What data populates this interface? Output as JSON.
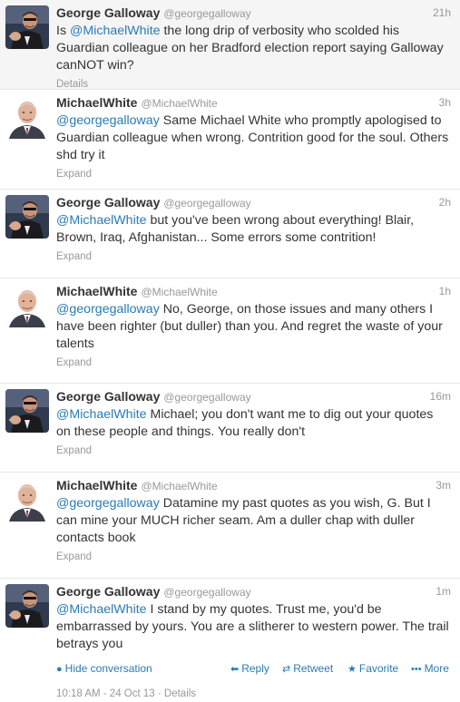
{
  "tweets": [
    {
      "author": "george",
      "fullname": "George Galloway",
      "username": "@georgegalloway",
      "time": "21h",
      "parts": [
        {
          "t": "Is ",
          "m": false
        },
        {
          "t": "@MichaelWhite",
          "m": true
        },
        {
          "t": " the long drip of verbosity who scolded his Guardian colleague on her Bradford election report saying Galloway canNOT win?",
          "m": false
        }
      ],
      "expand": "Details"
    },
    {
      "author": "michael",
      "fullname": "MichaelWhite",
      "username": "@MichaelWhite",
      "time": "3h",
      "parts": [
        {
          "t": "@georgegalloway",
          "m": true
        },
        {
          "t": " Same Michael White who promptly apologised to Guardian colleague when wrong. Contrition good for the soul. Others shd try it",
          "m": false
        }
      ],
      "expand": "Expand"
    },
    {
      "author": "george",
      "fullname": "George Galloway",
      "username": "@georgegalloway",
      "time": "2h",
      "parts": [
        {
          "t": "@MichaelWhite",
          "m": true
        },
        {
          "t": " but you've been wrong about everything! Blair, Brown, Iraq, Afghanistan... Some errors some contrition!",
          "m": false
        }
      ],
      "expand": "Expand"
    },
    {
      "author": "michael",
      "fullname": "MichaelWhite",
      "username": "@MichaelWhite",
      "time": "1h",
      "parts": [
        {
          "t": "@georgegalloway",
          "m": true
        },
        {
          "t": " No, George, on those issues and many others I have been righter (but duller) than you. And regret the waste of your talents",
          "m": false
        }
      ],
      "expand": "Expand"
    },
    {
      "author": "george",
      "fullname": "George Galloway",
      "username": "@georgegalloway",
      "time": "16m",
      "parts": [
        {
          "t": "@MichaelWhite",
          "m": true
        },
        {
          "t": " Michael; you don't want me to dig out your quotes on these people and things. You really don't",
          "m": false
        }
      ],
      "expand": "Expand"
    },
    {
      "author": "michael",
      "fullname": "MichaelWhite",
      "username": "@MichaelWhite",
      "time": "3m",
      "parts": [
        {
          "t": "@georgegalloway",
          "m": true
        },
        {
          "t": " Datamine my past quotes as you wish, G. But  I can  mine your  MUCH richer seam. Am a duller chap with duller contacts book",
          "m": false
        }
      ],
      "expand": "Expand"
    },
    {
      "author": "george",
      "fullname": "George Galloway",
      "username": "@georgegalloway",
      "time": "1m",
      "parts": [
        {
          "t": "@MichaelWhite",
          "m": true
        },
        {
          "t": " I stand by my quotes. Trust me, you'd be embarrassed by yours. You are a slitherer to western power. The trail betrays you",
          "m": false
        }
      ],
      "expand": ""
    }
  ],
  "actions": {
    "hide_label": "Hide conversation",
    "reply_label": "Reply",
    "retweet_label": "Retweet",
    "favorite_label": "Favorite",
    "more_label": "More",
    "hide_icon": "speech-bubble-icon",
    "reply_icon": "reply-arrow-icon",
    "retweet_icon": "retweet-icon",
    "favorite_icon": "star-icon",
    "more_icon": "ellipsis-icon"
  },
  "meta": {
    "timestamp": "10:18 AM - 24 Oct 13",
    "separator": " · ",
    "details_label": "Details"
  },
  "colors": {
    "link": "#2a7bb5",
    "muted": "#999999",
    "text": "#333333",
    "highlight_bg": "#f5f5f5"
  }
}
